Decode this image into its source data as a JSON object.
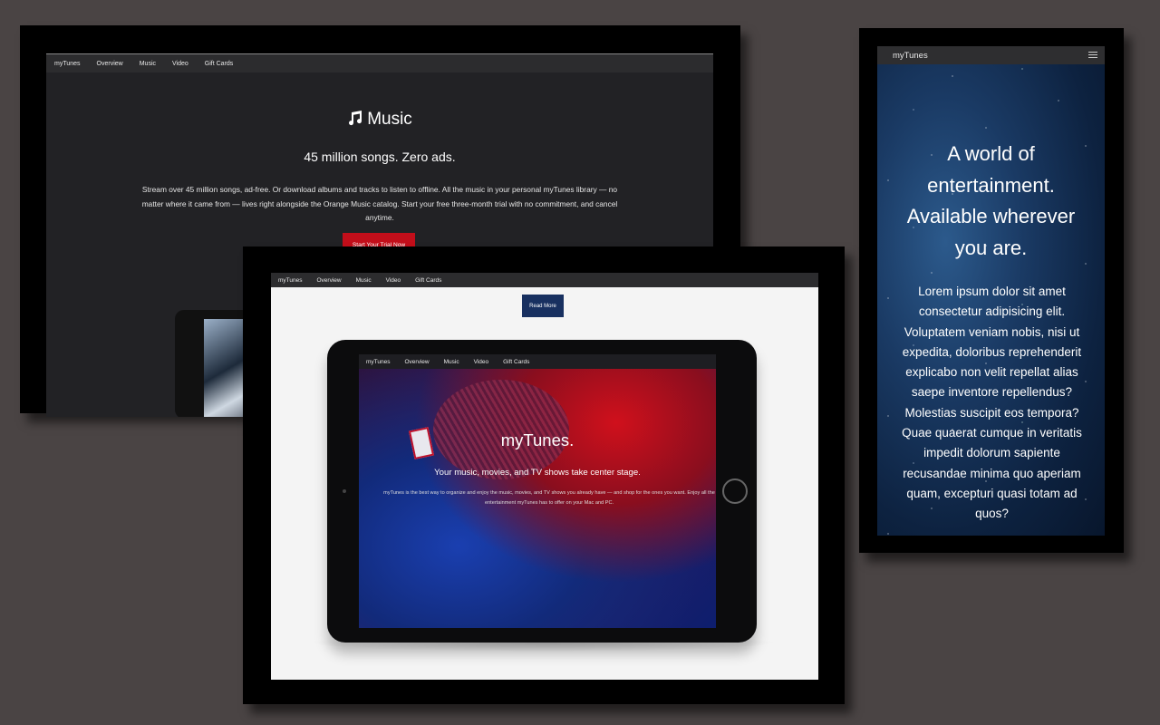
{
  "nav": {
    "brand": "myTunes",
    "items": [
      "Overview",
      "Music",
      "Video",
      "Gift Cards"
    ]
  },
  "desktop": {
    "music_title": "Music",
    "music_subtitle": "45 million songs. Zero ads.",
    "music_body": "Stream over 45 million songs, ad-free. Or download albums and tracks to listen to offline. All the music in your personal myTunes library — no matter where it came from — lives right alongside the Orange Music catalog. Start your free three-month trial with no commitment, and cancel anytime.",
    "trial_button": "Start Your Trial Now"
  },
  "tablet": {
    "read_more": "Read More",
    "hero_title": "myTunes.",
    "hero_subtitle": "Your music, movies, and TV shows take center stage.",
    "hero_body": "myTunes is the best way to organize and enjoy the music, movies, and TV shows you already have — and shop for the ones you want. Enjoy all the entertainment myTunes has to offer on your Mac and PC."
  },
  "mobile": {
    "brand": "myTunes",
    "title": "A world of entertainment. Available wherever you are.",
    "body": "Lorem ipsum dolor sit amet consectetur adipisicing elit. Voluptatem veniam nobis, nisi ut expedita, doloribus reprehenderit explicabo non velit repellat alias saepe inventore repellendus? Molestias suscipit eos tempora? Quae quaerat cumque in veritatis impedit dolorum sapiente recusandae minima quo aperiam quam, excepturi quasi totam ad quos?"
  },
  "colors": {
    "background": "#4a4444",
    "trial_button": "#c20e1a",
    "read_more_button": "#183060",
    "nav_bar": "#2c2c2e"
  }
}
